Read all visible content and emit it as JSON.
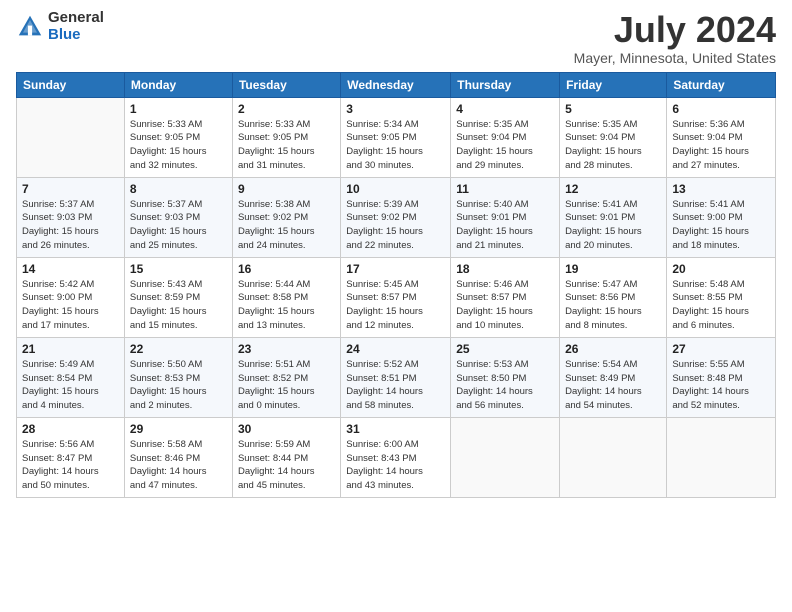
{
  "header": {
    "logo_general": "General",
    "logo_blue": "Blue",
    "title": "July 2024",
    "subtitle": "Mayer, Minnesota, United States"
  },
  "days_of_week": [
    "Sunday",
    "Monday",
    "Tuesday",
    "Wednesday",
    "Thursday",
    "Friday",
    "Saturday"
  ],
  "weeks": [
    [
      {
        "day": "",
        "info": ""
      },
      {
        "day": "1",
        "info": "Sunrise: 5:33 AM\nSunset: 9:05 PM\nDaylight: 15 hours\nand 32 minutes."
      },
      {
        "day": "2",
        "info": "Sunrise: 5:33 AM\nSunset: 9:05 PM\nDaylight: 15 hours\nand 31 minutes."
      },
      {
        "day": "3",
        "info": "Sunrise: 5:34 AM\nSunset: 9:05 PM\nDaylight: 15 hours\nand 30 minutes."
      },
      {
        "day": "4",
        "info": "Sunrise: 5:35 AM\nSunset: 9:04 PM\nDaylight: 15 hours\nand 29 minutes."
      },
      {
        "day": "5",
        "info": "Sunrise: 5:35 AM\nSunset: 9:04 PM\nDaylight: 15 hours\nand 28 minutes."
      },
      {
        "day": "6",
        "info": "Sunrise: 5:36 AM\nSunset: 9:04 PM\nDaylight: 15 hours\nand 27 minutes."
      }
    ],
    [
      {
        "day": "7",
        "info": "Sunrise: 5:37 AM\nSunset: 9:03 PM\nDaylight: 15 hours\nand 26 minutes."
      },
      {
        "day": "8",
        "info": "Sunrise: 5:37 AM\nSunset: 9:03 PM\nDaylight: 15 hours\nand 25 minutes."
      },
      {
        "day": "9",
        "info": "Sunrise: 5:38 AM\nSunset: 9:02 PM\nDaylight: 15 hours\nand 24 minutes."
      },
      {
        "day": "10",
        "info": "Sunrise: 5:39 AM\nSunset: 9:02 PM\nDaylight: 15 hours\nand 22 minutes."
      },
      {
        "day": "11",
        "info": "Sunrise: 5:40 AM\nSunset: 9:01 PM\nDaylight: 15 hours\nand 21 minutes."
      },
      {
        "day": "12",
        "info": "Sunrise: 5:41 AM\nSunset: 9:01 PM\nDaylight: 15 hours\nand 20 minutes."
      },
      {
        "day": "13",
        "info": "Sunrise: 5:41 AM\nSunset: 9:00 PM\nDaylight: 15 hours\nand 18 minutes."
      }
    ],
    [
      {
        "day": "14",
        "info": "Sunrise: 5:42 AM\nSunset: 9:00 PM\nDaylight: 15 hours\nand 17 minutes."
      },
      {
        "day": "15",
        "info": "Sunrise: 5:43 AM\nSunset: 8:59 PM\nDaylight: 15 hours\nand 15 minutes."
      },
      {
        "day": "16",
        "info": "Sunrise: 5:44 AM\nSunset: 8:58 PM\nDaylight: 15 hours\nand 13 minutes."
      },
      {
        "day": "17",
        "info": "Sunrise: 5:45 AM\nSunset: 8:57 PM\nDaylight: 15 hours\nand 12 minutes."
      },
      {
        "day": "18",
        "info": "Sunrise: 5:46 AM\nSunset: 8:57 PM\nDaylight: 15 hours\nand 10 minutes."
      },
      {
        "day": "19",
        "info": "Sunrise: 5:47 AM\nSunset: 8:56 PM\nDaylight: 15 hours\nand 8 minutes."
      },
      {
        "day": "20",
        "info": "Sunrise: 5:48 AM\nSunset: 8:55 PM\nDaylight: 15 hours\nand 6 minutes."
      }
    ],
    [
      {
        "day": "21",
        "info": "Sunrise: 5:49 AM\nSunset: 8:54 PM\nDaylight: 15 hours\nand 4 minutes."
      },
      {
        "day": "22",
        "info": "Sunrise: 5:50 AM\nSunset: 8:53 PM\nDaylight: 15 hours\nand 2 minutes."
      },
      {
        "day": "23",
        "info": "Sunrise: 5:51 AM\nSunset: 8:52 PM\nDaylight: 15 hours\nand 0 minutes."
      },
      {
        "day": "24",
        "info": "Sunrise: 5:52 AM\nSunset: 8:51 PM\nDaylight: 14 hours\nand 58 minutes."
      },
      {
        "day": "25",
        "info": "Sunrise: 5:53 AM\nSunset: 8:50 PM\nDaylight: 14 hours\nand 56 minutes."
      },
      {
        "day": "26",
        "info": "Sunrise: 5:54 AM\nSunset: 8:49 PM\nDaylight: 14 hours\nand 54 minutes."
      },
      {
        "day": "27",
        "info": "Sunrise: 5:55 AM\nSunset: 8:48 PM\nDaylight: 14 hours\nand 52 minutes."
      }
    ],
    [
      {
        "day": "28",
        "info": "Sunrise: 5:56 AM\nSunset: 8:47 PM\nDaylight: 14 hours\nand 50 minutes."
      },
      {
        "day": "29",
        "info": "Sunrise: 5:58 AM\nSunset: 8:46 PM\nDaylight: 14 hours\nand 47 minutes."
      },
      {
        "day": "30",
        "info": "Sunrise: 5:59 AM\nSunset: 8:44 PM\nDaylight: 14 hours\nand 45 minutes."
      },
      {
        "day": "31",
        "info": "Sunrise: 6:00 AM\nSunset: 8:43 PM\nDaylight: 14 hours\nand 43 minutes."
      },
      {
        "day": "",
        "info": ""
      },
      {
        "day": "",
        "info": ""
      },
      {
        "day": "",
        "info": ""
      }
    ]
  ]
}
